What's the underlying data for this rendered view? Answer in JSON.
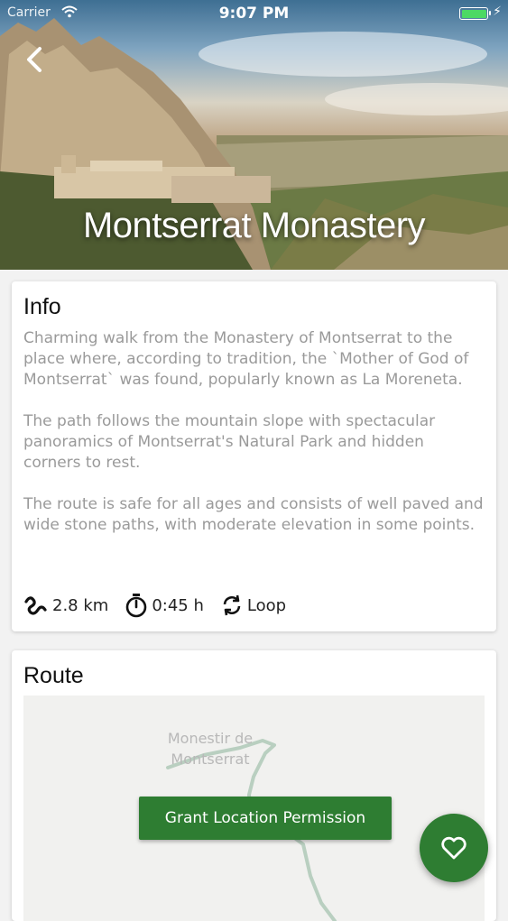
{
  "status_bar": {
    "carrier": "Carrier",
    "time": "9:07 PM"
  },
  "hero": {
    "title": "Montserrat Monastery"
  },
  "info": {
    "title": "Info",
    "paragraphs": [
      "Charming walk from the Monastery of Montserrat to the place where, according to tradition, the `Mother of God of Montserrat` was found, popularly known as La Moreneta.",
      "The path follows the mountain slope with spectacular panoramics of Montserrat's Natural Park and hidden corners to rest.",
      "The route is safe for all ages and consists of well paved and wide stone paths, with moderate elevation in some points."
    ],
    "distance": "2.8 km",
    "duration": "0:45 h",
    "route_type": "Loop"
  },
  "route": {
    "title": "Route",
    "map_label": "Monestir de Montserrat",
    "permission_button": "Grant Location Permission"
  },
  "colors": {
    "accent": "#2e7d32",
    "battery": "#4cd964"
  }
}
